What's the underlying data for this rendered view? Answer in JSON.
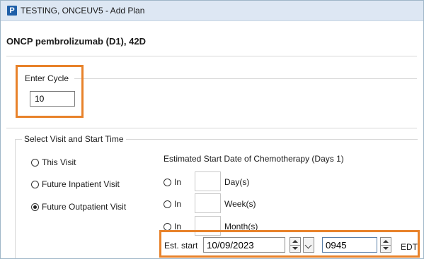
{
  "window": {
    "app_icon_letter": "P",
    "title": "TESTING, ONCEUV5 - Add Plan"
  },
  "plan": {
    "name": "ONCP pembrolizumab (D1), 42D"
  },
  "cycle": {
    "label": "Enter Cycle",
    "value": "10"
  },
  "visit": {
    "group_label": "Select Visit and Start Time",
    "options": [
      {
        "label": "This Visit",
        "selected": false
      },
      {
        "label": "Future Inpatient Visit",
        "selected": false
      },
      {
        "label": "Future Outpatient Visit",
        "selected": true
      }
    ]
  },
  "estimate": {
    "heading": "Estimated Start Date of Chemotherapy (Days 1)",
    "rows": [
      {
        "prefix": "In",
        "unit": "Day(s)",
        "value": ""
      },
      {
        "prefix": "In",
        "unit": "Week(s)",
        "value": ""
      },
      {
        "prefix": "In",
        "unit": "Month(s)",
        "value": ""
      }
    ],
    "est_start_label": "Est. start",
    "date_value": "10/09/2023",
    "time_value": "0945",
    "timezone": "EDT"
  },
  "colors": {
    "highlight": "#e8822a",
    "title_bar": "#dde7f3",
    "app_icon": "#1f5fa8"
  }
}
